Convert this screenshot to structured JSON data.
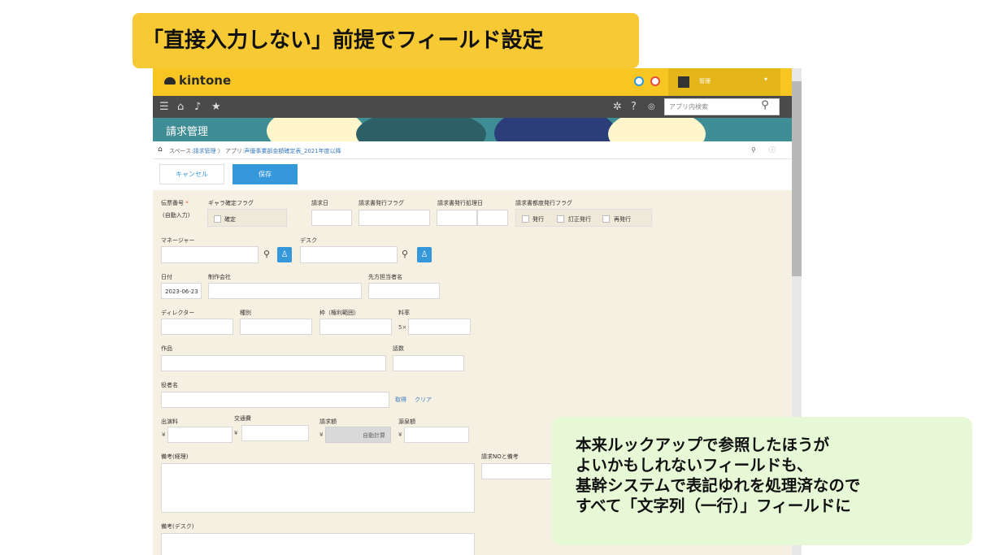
{
  "banner": {
    "title": "「直接入力しない」前提でフィールド設定"
  },
  "app": {
    "logo": "kintone",
    "user": "管理",
    "search_placeholder": "アプリ内検索",
    "title": "請求管理",
    "breadcrumb": {
      "space_prefix": "スペース:",
      "space": "請求管理",
      "app_prefix": "アプリ:",
      "app": "声優事業部金額確定表_2021年度以降"
    }
  },
  "actions": {
    "cancel": "キャンセル",
    "save": "保存"
  },
  "form": {
    "denpyo_label": "伝票番号",
    "required_mark": "*",
    "denpyo_value": "(自動入力)",
    "gyara_label": "ギャラ確定フラグ",
    "gyara_opt": "確定",
    "seikyubi_label": "請求日",
    "hakko_flag_label": "請求書発行フラグ",
    "hakko_shori_label": "請求書発行処理日",
    "budo_label": "請求書都度発行フラグ",
    "budo_opts": [
      "発行",
      "訂正発行",
      "再発行"
    ],
    "manager_label": "マネージャー",
    "desk_label": "デスク",
    "date_label": "日付",
    "date_value": "2023-06-23",
    "seisaku_label": "制作会社",
    "tanto_label": "先方担当者名",
    "director_label": "ディレクター",
    "shubetsu_label": "種別",
    "waku_label": "枠（権利範囲）",
    "ryoritsu_label": "料率",
    "ryoritsu_prefix": "5×",
    "sakuhin_label": "作品",
    "wasu_label": "話数",
    "yakusha_label": "役者名",
    "shutoku": "取得",
    "clear": "クリア",
    "shutsuen_label": "出演料",
    "kotsu_label": "交通費",
    "seikyu_label": "請求額",
    "gensen_label": "源泉額",
    "yen": "¥",
    "auto_calc": "自動計算",
    "biko_keiri_label": "備考(経理)",
    "seikyu_no_label": "請求NOと備考",
    "biko_desk_label": "備考(デスク)"
  },
  "note": {
    "lines": [
      "本来ルックアップで参照したほうが",
      "よいかもしれないフィールドも、",
      "基幹システムで表記ゆれを処理済なので",
      "すべて「文字列（一行）」フィールドに"
    ]
  },
  "colors": {
    "banner": "#f7c934",
    "topbar": "#f7c622",
    "navbar": "#4a4a4a",
    "header": "#3f8d95",
    "accent": "#3498db",
    "form_bg": "#f5f0e1",
    "note_bg": "#e7f8d7"
  }
}
